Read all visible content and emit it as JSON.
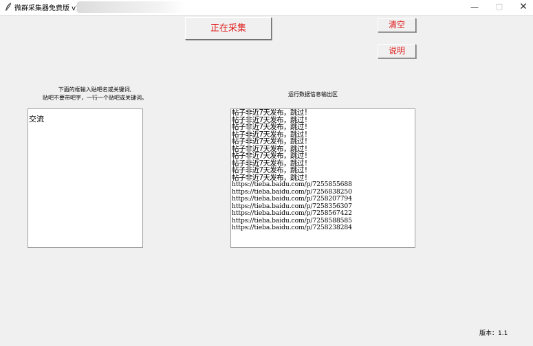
{
  "window": {
    "title": "微群采集器免费版 v1.",
    "controls": {
      "minimize": "—",
      "maximize": "□",
      "close": "✕"
    }
  },
  "buttons": {
    "start": "正在采集",
    "clear": "清空",
    "help": "说明"
  },
  "left_panel": {
    "instruction_line1": "下面的框输入贴吧名或关键词,",
    "instruction_line2": "贴吧不要带吧字，一行一个贴吧或关键词。",
    "input_value": "交流"
  },
  "right_panel": {
    "label": "运行数据信息输出区",
    "output_lines": [
      "帖子非近7天发布，跳过!",
      "帖子非近7天发布，跳过!",
      "帖子非近7天发布，跳过!",
      "帖子非近7天发布，跳过!",
      "帖子非近7天发布，跳过!",
      "帖子非近7天发布，跳过!",
      "帖子非近7天发布，跳过!",
      "帖子非近7天发布，跳过!",
      "帖子非近7天发布，跳过!",
      "帖子非近7天发布，跳过!",
      "https://tieba.baidu.com/p/7255855688",
      "https://tieba.baidu.com/p/7256838250",
      "https://tieba.baidu.com/p/7258207794",
      "https://tieba.baidu.com/p/7258356307",
      "https://tieba.baidu.com/p/7258567422",
      "https://tieba.baidu.com/p/7258588585",
      "https://tieba.baidu.com/p/7258238284"
    ]
  },
  "footer": {
    "version": "版本：1.1"
  },
  "colors": {
    "accent": "#e02020",
    "background": "#f0f0f0"
  },
  "icons": {
    "app": "feather-icon"
  }
}
